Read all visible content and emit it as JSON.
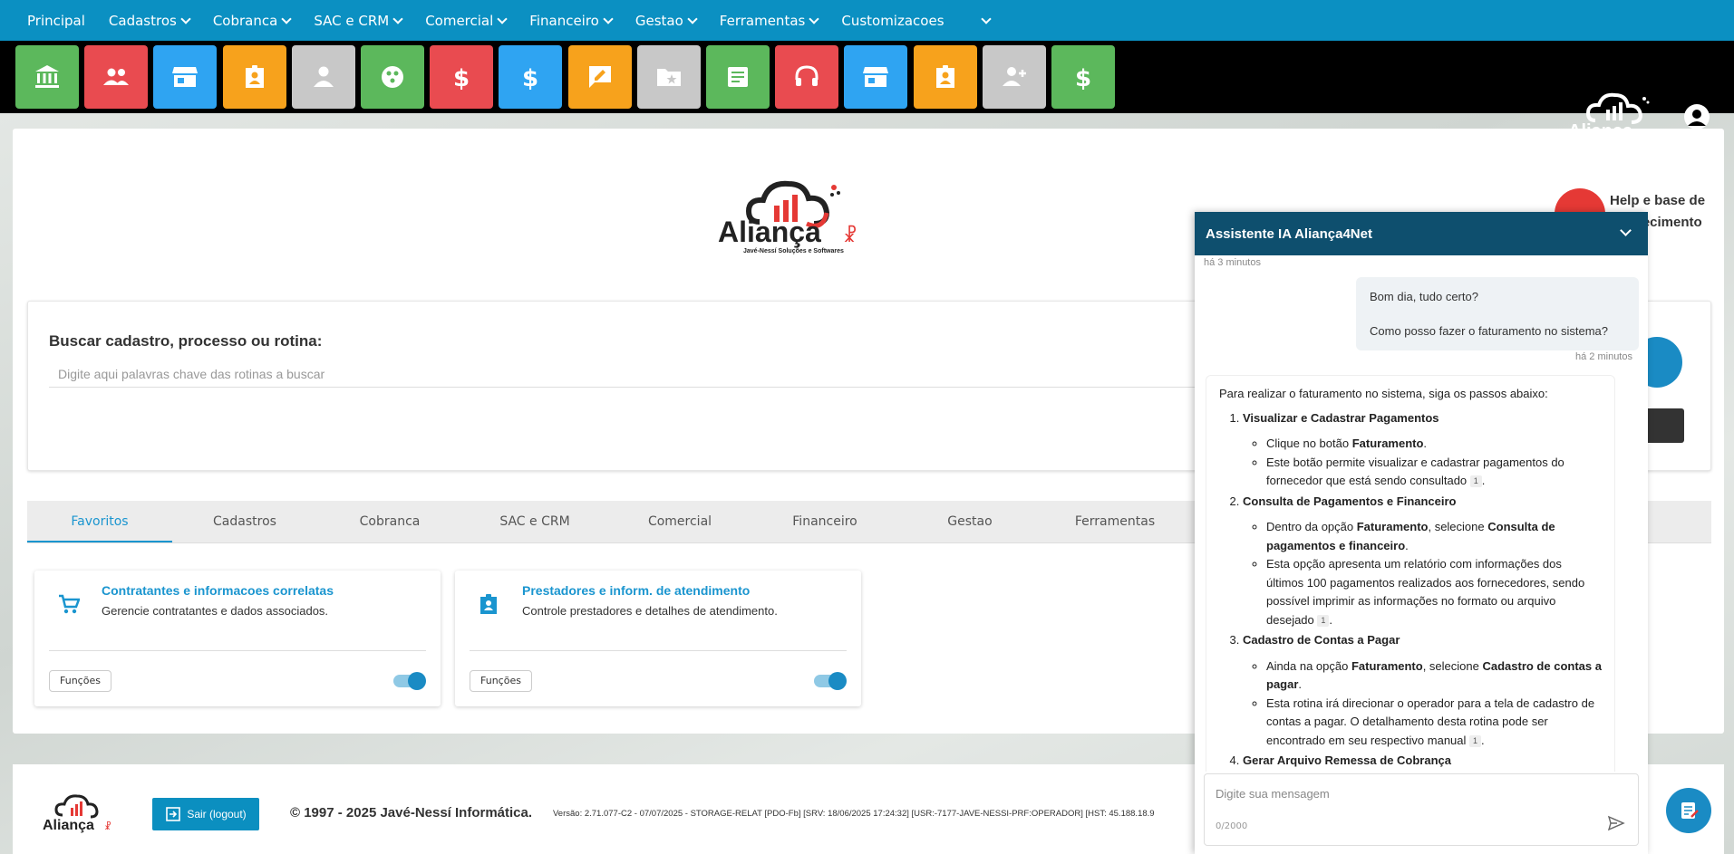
{
  "topnav": {
    "items": [
      {
        "label": "Principal",
        "dropdown": false
      },
      {
        "label": "Cadastros",
        "dropdown": true
      },
      {
        "label": "Cobranca",
        "dropdown": true
      },
      {
        "label": "SAC e CRM",
        "dropdown": true
      },
      {
        "label": "Comercial",
        "dropdown": true
      },
      {
        "label": "Financeiro",
        "dropdown": true
      },
      {
        "label": "Gestao",
        "dropdown": true
      },
      {
        "label": "Ferramentas",
        "dropdown": true
      },
      {
        "label": "Customizacoes",
        "dropdown": true
      }
    ],
    "color": "#0b90c2"
  },
  "toolbar": {
    "tiles": [
      {
        "icon": "bank-icon",
        "color": "#5cb85c"
      },
      {
        "icon": "people-icon",
        "color": "#e94b50"
      },
      {
        "icon": "store-icon",
        "color": "#2fa4f2"
      },
      {
        "icon": "badge-icon",
        "color": "#f7a21c"
      },
      {
        "icon": "person-icon",
        "color": "#c8c8c8"
      },
      {
        "icon": "hub-icon",
        "color": "#5cb85c"
      },
      {
        "icon": "dollar-icon",
        "color": "#e94b50"
      },
      {
        "icon": "dollar-icon",
        "color": "#2fa4f2"
      },
      {
        "icon": "rate-review-icon",
        "color": "#f7a21c"
      },
      {
        "icon": "folder-star-icon",
        "color": "#c8c8c8"
      },
      {
        "icon": "article-icon",
        "color": "#5cb85c"
      },
      {
        "icon": "headset-icon",
        "color": "#e94b50"
      },
      {
        "icon": "store-icon",
        "color": "#2fa4f2"
      },
      {
        "icon": "badge-icon",
        "color": "#f7a21c"
      },
      {
        "icon": "person-add-icon",
        "color": "#c8c8c8"
      },
      {
        "icon": "dollar-icon",
        "color": "#5cb85c"
      }
    ]
  },
  "brand": {
    "name": "Aliança",
    "tagline": "Javé-Nessí Soluções e Softwares"
  },
  "search": {
    "title": "Buscar cadastro, processo ou rotina:",
    "placeholder": "Digite aqui palavras chave das rotinas a buscar"
  },
  "tabs": [
    "Favoritos",
    "Cadastros",
    "Cobranca",
    "SAC e CRM",
    "Comercial",
    "Financeiro",
    "Gestao",
    "Ferramentas"
  ],
  "active_tab": "Favoritos",
  "favorites": [
    {
      "title": "Contratantes e informacoes correlatas",
      "desc": "Gerencie contratantes e dados associados.",
      "button": "Funções",
      "enabled": true,
      "icon": "cart-icon"
    },
    {
      "title": "Prestadores e inform. de atendimento",
      "desc": "Controle prestadores e detalhes de atendimento.",
      "button": "Funções",
      "enabled": true,
      "icon": "badge-icon"
    }
  ],
  "help": {
    "text": "Help e base de conhecimento"
  },
  "footer": {
    "logout": "Sair (logout)",
    "copyright": "© 1997 - 2025 Javé-Nessí Informática.",
    "version": "Versão: 2.71.077-C2 - 07/07/2025 - STORAGE-RELAT [PDO-Fb] [SRV: 18/06/2025 17:24:32] [USR:-7177-JAVE-NESSI-PRF:OPERADOR] [HST: 45.188.18.9"
  },
  "chat": {
    "title": "Assistente IA Aliança4Net",
    "time1": "há 3 minutos",
    "time2": "há 2 minutos",
    "user_lines": [
      "Bom dia, tudo certo?",
      "Como posso fazer o faturamento no sistema?"
    ],
    "intro": "Para realizar o faturamento no sistema, siga os passos abaixo:",
    "steps": [
      {
        "title": "Visualizar e Cadastrar Pagamentos",
        "items": [
          {
            "pre": "Clique no botão ",
            "b1": "Faturamento",
            "mid": ".",
            "b2": "",
            "post": "",
            "ref": ""
          },
          {
            "pre": "Este botão permite visualizar e cadastrar pagamentos do fornecedor que está sendo consultado ",
            "b1": "",
            "mid": "",
            "b2": "",
            "post": ".",
            "ref": "1"
          }
        ]
      },
      {
        "title": "Consulta de Pagamentos e Financeiro",
        "items": [
          {
            "pre": "Dentro da opção ",
            "b1": "Faturamento",
            "mid": ", selecione ",
            "b2": "Consulta de pagamentos e financeiro",
            "post": ".",
            "ref": ""
          },
          {
            "pre": "Esta opção apresenta um relatório com informações dos últimos 100 pagamentos realizados aos fornecedores, sendo possível imprimir as informações no formato ou arquivo desejado ",
            "b1": "",
            "mid": "",
            "b2": "",
            "post": ".",
            "ref": "1"
          }
        ]
      },
      {
        "title": "Cadastro de Contas a Pagar",
        "items": [
          {
            "pre": "Ainda na opção ",
            "b1": "Faturamento",
            "mid": ", selecione ",
            "b2": "Cadastro de contas a pagar",
            "post": ".",
            "ref": ""
          },
          {
            "pre": "Esta rotina irá direcionar o operador para a tela de cadastro de contas a pagar. O detalhamento desta rotina pode ser encontrado em seu respectivo manual ",
            "b1": "",
            "mid": "",
            "b2": "",
            "post": ".",
            "ref": "1"
          }
        ]
      },
      {
        "title": "Gerar Arquivo Remessa de Cobrança",
        "items": []
      }
    ],
    "input_placeholder": "Digite sua mensagem",
    "counter": "0/2000"
  }
}
